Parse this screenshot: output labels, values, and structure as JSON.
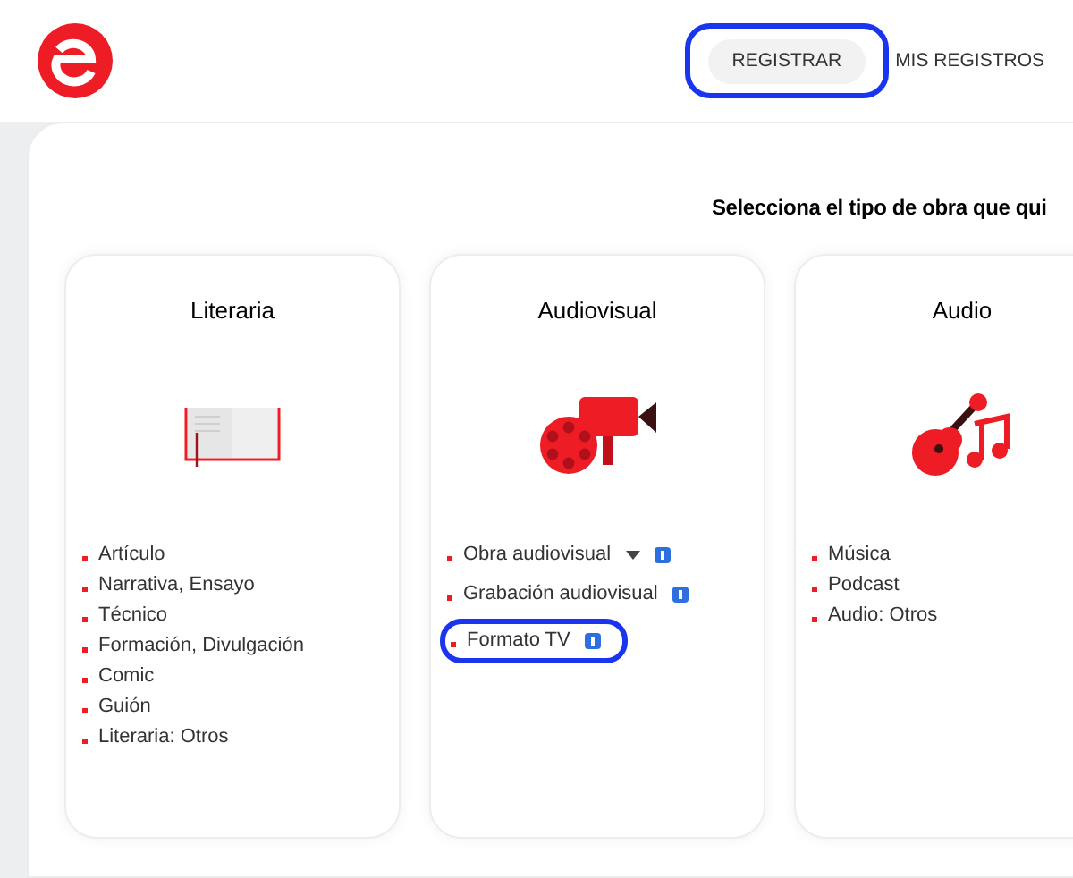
{
  "nav": [
    {
      "label": "REGISTRAR",
      "selected": true,
      "highlighted": true
    },
    {
      "label": "MIS REGISTROS",
      "selected": false,
      "highlighted": false
    }
  ],
  "heading": "Selecciona el tipo de obra que qui",
  "cards": [
    {
      "title": "Literaria",
      "items": [
        {
          "label": "Artículo",
          "dropdown": false,
          "info": false,
          "highlighted": false
        },
        {
          "label": "Narrativa, Ensayo",
          "dropdown": false,
          "info": false,
          "highlighted": false
        },
        {
          "label": "Técnico",
          "dropdown": false,
          "info": false,
          "highlighted": false
        },
        {
          "label": "Formación, Divulgación",
          "dropdown": false,
          "info": false,
          "highlighted": false
        },
        {
          "label": "Comic",
          "dropdown": false,
          "info": false,
          "highlighted": false
        },
        {
          "label": "Guión",
          "dropdown": false,
          "info": false,
          "highlighted": false
        },
        {
          "label": "Literaria: Otros",
          "dropdown": false,
          "info": false,
          "highlighted": false
        }
      ]
    },
    {
      "title": "Audiovisual",
      "items": [
        {
          "label": "Obra audiovisual",
          "dropdown": true,
          "info": true,
          "highlighted": false
        },
        {
          "label": "Grabación audiovisual",
          "dropdown": false,
          "info": true,
          "highlighted": false
        },
        {
          "label": "Formato TV",
          "dropdown": false,
          "info": true,
          "highlighted": true
        }
      ]
    },
    {
      "title": "Audio",
      "items": [
        {
          "label": "Música",
          "dropdown": false,
          "info": false,
          "highlighted": false
        },
        {
          "label": "Podcast",
          "dropdown": false,
          "info": false,
          "highlighted": false
        },
        {
          "label": "Audio: Otros",
          "dropdown": false,
          "info": false,
          "highlighted": false
        }
      ]
    }
  ]
}
